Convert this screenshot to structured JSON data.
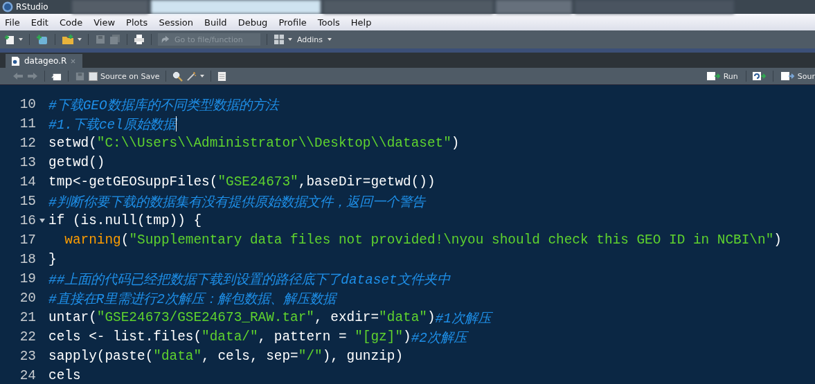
{
  "window": {
    "title": "RStudio"
  },
  "menu": [
    "File",
    "Edit",
    "Code",
    "View",
    "Plots",
    "Session",
    "Build",
    "Debug",
    "Profile",
    "Tools",
    "Help"
  ],
  "toolbar": {
    "search": {
      "placeholder": "Go to file/function"
    },
    "addins": "Addins"
  },
  "editor_tabs": [
    {
      "label": "datageo.R",
      "selected": true
    }
  ],
  "editor_toolbar": {
    "source_on_save": {
      "label": "Source on Save",
      "checked": false
    },
    "run": "Run",
    "source": "Sour"
  },
  "code_lines": [
    {
      "number": "10",
      "foldable": false,
      "cursor": false,
      "tokens": [
        {
          "kind": "comment",
          "text": "#下载GEO数据库的不同类型数据的方法"
        }
      ]
    },
    {
      "number": "11",
      "foldable": false,
      "cursor": true,
      "tokens": [
        {
          "kind": "comment",
          "text": "#1.下载cel原始数据"
        }
      ]
    },
    {
      "number": "12",
      "foldable": false,
      "cursor": false,
      "tokens": [
        {
          "kind": "plain",
          "text": "setwd("
        },
        {
          "kind": "string",
          "text": "\"C:\\\\Users\\\\Administrator\\\\Desktop\\\\dataset\""
        },
        {
          "kind": "plain",
          "text": ")"
        }
      ]
    },
    {
      "number": "13",
      "foldable": false,
      "cursor": false,
      "tokens": [
        {
          "kind": "plain",
          "text": "getwd()"
        }
      ]
    },
    {
      "number": "14",
      "foldable": false,
      "cursor": false,
      "tokens": [
        {
          "kind": "plain",
          "text": "tmp<-getGEOSuppFiles("
        },
        {
          "kind": "string",
          "text": "\"GSE24673\""
        },
        {
          "kind": "plain",
          "text": ",baseDir=getwd())"
        }
      ]
    },
    {
      "number": "15",
      "foldable": false,
      "cursor": false,
      "tokens": [
        {
          "kind": "comment",
          "text": "#判断你要下载的数据集有没有提供原始数据文件，返回一个警告"
        }
      ]
    },
    {
      "number": "16",
      "foldable": true,
      "cursor": false,
      "tokens": [
        {
          "kind": "plain",
          "text": "if (is.null(tmp)) {"
        }
      ],
      "children": [
        {
          "number": "17",
          "foldable": false,
          "cursor": false,
          "tokens": [
            {
              "kind": "function",
              "text": "warning"
            },
            {
              "kind": "plain",
              "text": "("
            },
            {
              "kind": "string",
              "text": "\"Supplementary data files not provided!\\nyou should check this GEO ID in NCBI\\n\""
            },
            {
              "kind": "plain",
              "text": ")"
            }
          ]
        }
      ]
    },
    {
      "number": "18",
      "foldable": false,
      "cursor": false,
      "tokens": [
        {
          "kind": "plain",
          "text": "}"
        }
      ]
    },
    {
      "number": "19",
      "foldable": false,
      "cursor": false,
      "tokens": [
        {
          "kind": "comment",
          "text": "##上面的代码已经把数据下载到设置的路径底下了dataset文件夹中"
        }
      ]
    },
    {
      "number": "20",
      "foldable": false,
      "cursor": false,
      "tokens": [
        {
          "kind": "comment",
          "text": "#直接在R里需进行2次解压：解包数据、解压数据"
        }
      ]
    },
    {
      "number": "21",
      "foldable": false,
      "cursor": false,
      "tokens": [
        {
          "kind": "plain",
          "text": "untar("
        },
        {
          "kind": "string",
          "text": "\"GSE24673/GSE24673_RAW.tar\""
        },
        {
          "kind": "plain",
          "text": ", exdir="
        },
        {
          "kind": "string",
          "text": "\"data\""
        },
        {
          "kind": "plain",
          "text": ")"
        },
        {
          "kind": "comment",
          "text": "#1次解压"
        }
      ]
    },
    {
      "number": "22",
      "foldable": false,
      "cursor": false,
      "tokens": [
        {
          "kind": "plain",
          "text": "cels <- list.files("
        },
        {
          "kind": "string",
          "text": "\"data/\""
        },
        {
          "kind": "plain",
          "text": ", pattern = "
        },
        {
          "kind": "string",
          "text": "\"[gz]\""
        },
        {
          "kind": "plain",
          "text": ")"
        },
        {
          "kind": "comment",
          "text": "#2次解压"
        }
      ]
    },
    {
      "number": "23",
      "foldable": false,
      "cursor": false,
      "tokens": [
        {
          "kind": "plain",
          "text": "sapply(paste("
        },
        {
          "kind": "string",
          "text": "\"data\""
        },
        {
          "kind": "plain",
          "text": ", cels, sep="
        },
        {
          "kind": "string",
          "text": "\"/\""
        },
        {
          "kind": "plain",
          "text": "), gunzip)"
        }
      ]
    },
    {
      "number": "24",
      "foldable": false,
      "cursor": false,
      "tokens": [
        {
          "kind": "plain",
          "text": "cels"
        }
      ]
    }
  ]
}
